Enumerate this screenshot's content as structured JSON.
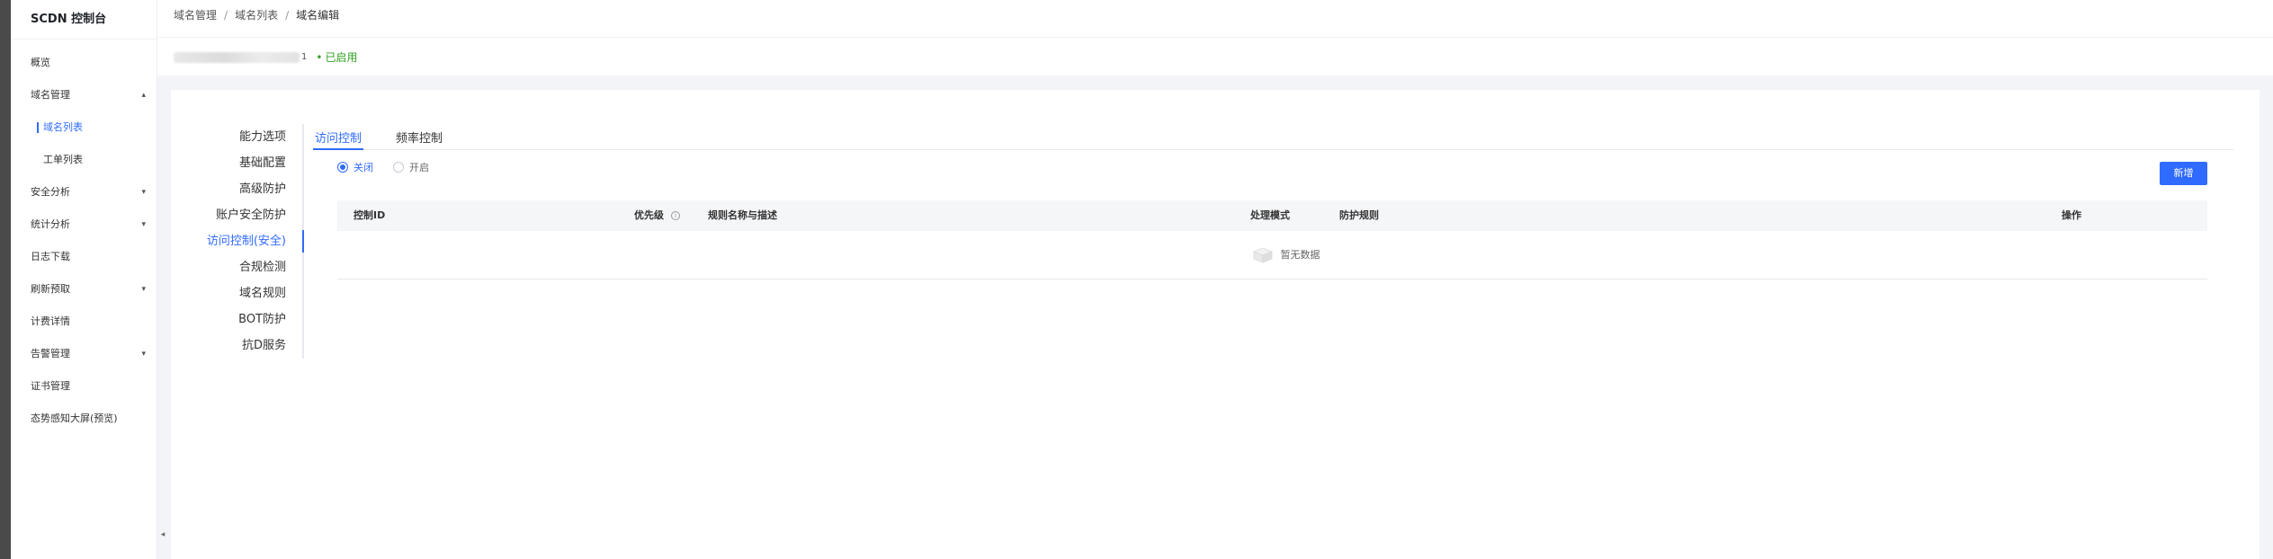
{
  "app": {
    "title": "SCDN 控制台"
  },
  "sidebar": {
    "items": [
      {
        "label": "概览",
        "caret": ""
      },
      {
        "label": "域名管理",
        "caret": "▴"
      },
      {
        "label": "域名列表",
        "caret": ""
      },
      {
        "label": "工单列表",
        "caret": ""
      },
      {
        "label": "安全分析",
        "caret": "▾"
      },
      {
        "label": "统计分析",
        "caret": "▾"
      },
      {
        "label": "日志下载",
        "caret": ""
      },
      {
        "label": "刷新预取",
        "caret": "▾"
      },
      {
        "label": "计费详情",
        "caret": ""
      },
      {
        "label": "告警管理",
        "caret": "▾"
      },
      {
        "label": "证书管理",
        "caret": ""
      },
      {
        "label": "态势感知大屏(预览)",
        "caret": ""
      }
    ],
    "collapse_icon": "◂"
  },
  "breadcrumb": [
    "域名管理",
    "域名列表",
    "域名编辑"
  ],
  "domain": {
    "suffix": "1",
    "status": "已启用",
    "status_color": "#2ea121"
  },
  "subnav": [
    "能力选项",
    "基础配置",
    "高级防护",
    "账户安全防护",
    "访问控制(安全)",
    "合规检测",
    "域名规则",
    "BOT防护",
    "抗D服务"
  ],
  "tabs": [
    "访问控制",
    "频率控制"
  ],
  "toggle": {
    "off": "关闭",
    "on": "开启",
    "selected": "关闭"
  },
  "add_button": "新增",
  "table": {
    "columns": [
      "控制ID",
      "优先级",
      "规则名称与描述",
      "处理模式",
      "防护规则",
      "操作"
    ],
    "empty_text": "暂无数据"
  },
  "colors": {
    "accent": "#2f6bff"
  }
}
